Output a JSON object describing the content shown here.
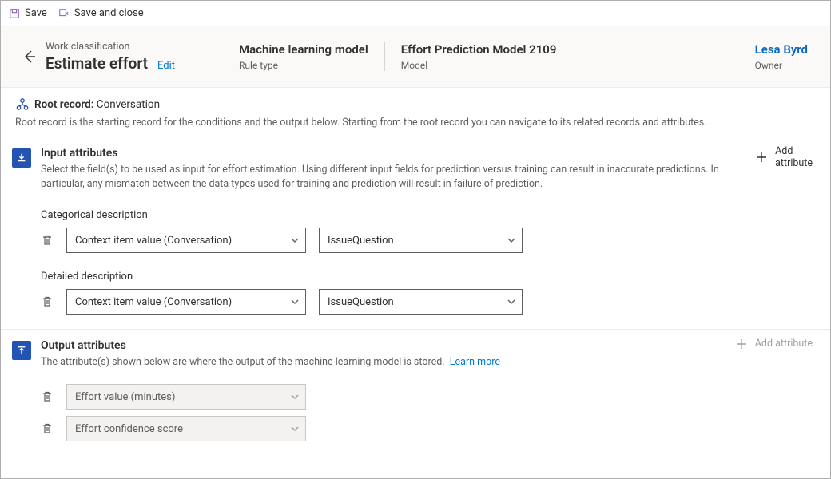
{
  "commands": {
    "save": "Save",
    "save_close": "Save and close"
  },
  "header": {
    "breadcrumb": "Work classification",
    "title": "Estimate effort",
    "edit": "Edit",
    "cols": [
      {
        "value": "Machine learning model",
        "label": "Rule type"
      },
      {
        "value": "Effort Prediction Model 2109",
        "label": "Model"
      }
    ],
    "owner": {
      "name": "Lesa Byrd",
      "label": "Owner"
    }
  },
  "root": {
    "label_bold": "Root record:",
    "label_value": "Conversation",
    "desc": "Root record is the starting record for the conditions and the output below. Starting from the root record you can navigate to its related records and attributes."
  },
  "sections": {
    "input": {
      "title": "Input attributes",
      "desc": "Select the field(s) to be used as input for effort estimation. Using different input fields for prediction versus training can result in inaccurate predictions. In particular, any mismatch between the data types used for training and prediction will result in failure of prediction.",
      "add1": "Add",
      "add2": "attribute",
      "groups": [
        {
          "label": "Categorical description",
          "v1": "Context item value (Conversation)",
          "v2": "IssueQuestion"
        },
        {
          "label": "Detailed description",
          "v1": "Context item value (Conversation)",
          "v2": "IssueQuestion"
        }
      ]
    },
    "output": {
      "title": "Output attributes",
      "desc": "The attribute(s) shown below are where the output of the machine learning model is stored.",
      "learn": "Learn more",
      "add": "Add attribute",
      "rows": [
        {
          "v": "Effort value (minutes)"
        },
        {
          "v": "Effort confidence score"
        }
      ]
    }
  }
}
